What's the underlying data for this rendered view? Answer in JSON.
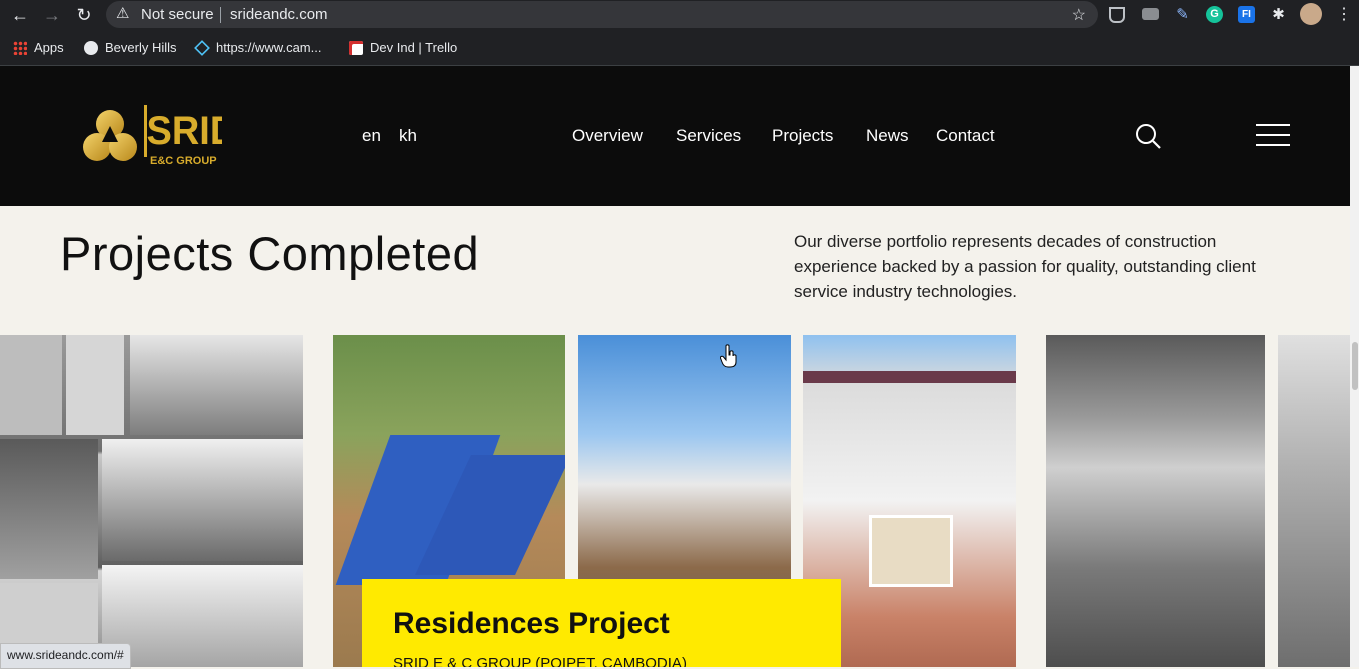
{
  "browser": {
    "security_label": "Not secure",
    "url": "srideandc.com",
    "status_url": "www.srideandc.com/#",
    "bookmarks": [
      {
        "label": "Apps",
        "icon": "apps-grid-icon"
      },
      {
        "label": "Beverly Hills",
        "icon": "globe-icon"
      },
      {
        "label": "https://www.cam...",
        "icon": "site-icon"
      },
      {
        "label": "Dev Ind | Trello",
        "icon": "trello-icon"
      }
    ],
    "extensions": [
      "shield-extension-icon",
      "printer-extension-icon",
      "pen-extension-icon",
      "grammarly-extension-icon",
      "fi-extension-icon",
      "puzzle-extension-icon",
      "profile-avatar"
    ]
  },
  "site": {
    "logo": {
      "brand": "SRID",
      "sub": "E&C GROUP"
    },
    "languages": [
      "en",
      "kh"
    ],
    "nav": [
      "Overview",
      "Services",
      "Projects",
      "News",
      "Contact"
    ]
  },
  "section": {
    "title": "Projects Completed",
    "description": "Our diverse portfolio represents decades of construction experience backed by a passion for quality, outstanding client service industry technologies."
  },
  "featured_card": {
    "title": "Residences Project",
    "subtitle": "SRID E & C GROUP (POIPET, CAMBODIA)"
  },
  "colors": {
    "header_bg": "#0c0c0c",
    "page_bg": "#f4f2ec",
    "accent_yellow": "#ffea00",
    "logo_gold": "#d8ac2c"
  }
}
